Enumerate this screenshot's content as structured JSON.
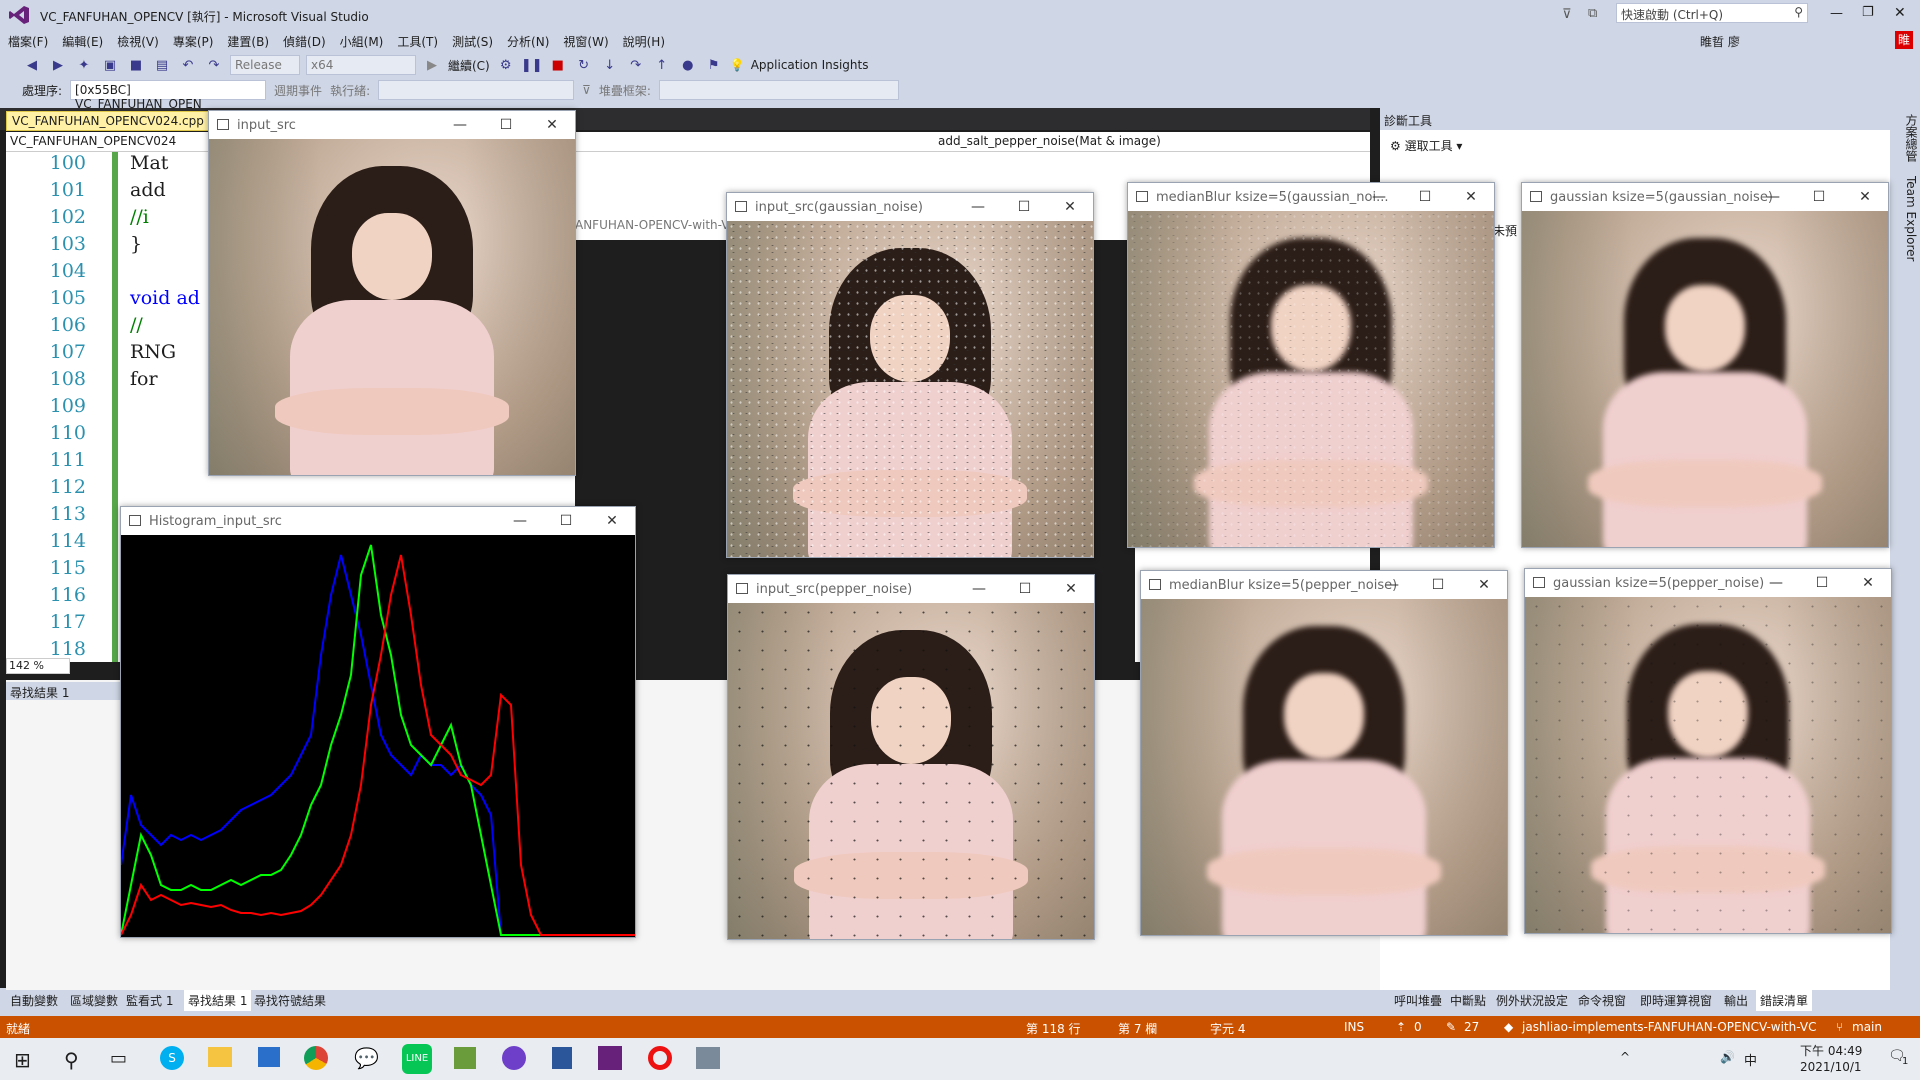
{
  "window": {
    "title": "VC_FANFUHAN_OPENCV [執行] - Microsoft Visual Studio",
    "quick_launch_placeholder": "快速啟動 (Ctrl+Q)",
    "user": "睢晢 廖",
    "user_badge": "睢"
  },
  "menu": [
    "檔案(F)",
    "編輯(E)",
    "檢視(V)",
    "專案(P)",
    "建置(B)",
    "偵錯(D)",
    "小組(M)",
    "工具(T)",
    "測試(S)",
    "分析(N)",
    "視窗(W)",
    "說明(H)"
  ],
  "toolbar": {
    "config": "Release",
    "platform": "x64",
    "continue": "繼續(C)",
    "app_insights": "Application Insights"
  },
  "toolbar2": {
    "process_label": "處理序:",
    "process_value": "[0x55BC] VC_FANFUHAN_OPEN",
    "lifecycle": "週期事件",
    "thread_label": "執行緒:",
    "stack_label": "堆疊框架:"
  },
  "editor": {
    "tab": "VC_FANFUHAN_OPENCV024.cpp",
    "nav_left": "VC_FANFUHAN_OPENCV024",
    "nav_right": "add_salt_pepper_noise(Mat & image)",
    "path_fragment": "ANFUHAN-OPENCV-with-V",
    "zoom": "142 %",
    "lines": [
      {
        "n": "100",
        "t": "Mat"
      },
      {
        "n": "101",
        "t": "add"
      },
      {
        "n": "102",
        "t": "//i"
      },
      {
        "n": "103",
        "t": "}"
      },
      {
        "n": "104",
        "t": ""
      },
      {
        "n": "105",
        "t": "void ad"
      },
      {
        "n": "106",
        "t": "//"
      },
      {
        "n": "107",
        "t": "RNG"
      },
      {
        "n": "108",
        "t": "for"
      },
      {
        "n": "109",
        "t": ""
      },
      {
        "n": "110",
        "t": ""
      },
      {
        "n": "111",
        "t": ""
      },
      {
        "n": "112",
        "t": ""
      },
      {
        "n": "113",
        "t": ""
      },
      {
        "n": "114",
        "t": ""
      },
      {
        "n": "115",
        "t": ""
      },
      {
        "n": "116",
        "t": ""
      },
      {
        "n": "117",
        "t": ""
      },
      {
        "n": "118",
        "t": ""
      }
    ]
  },
  "find_panel": {
    "title": "尋找結果 1"
  },
  "diagnostics": {
    "title": "診斷工具",
    "select_tool": "選取工具",
    "side_text": "未預"
  },
  "side_tabs": [
    "方案總管",
    "Team Explorer"
  ],
  "bottom_tabs_left": [
    "自動變數",
    "區域變數",
    "監看式 1",
    "尋找結果 1",
    "尋找符號結果"
  ],
  "bottom_tabs_right": [
    "呼叫堆疊",
    "中斷點",
    "例外狀況設定",
    "命令視窗",
    "即時運算視窗",
    "輸出",
    "錯誤清單"
  ],
  "status": {
    "ready": "就緒",
    "line": "第 118 行",
    "col": "第 7 欄",
    "char": "字元 4",
    "ins": "INS",
    "up": "0",
    "edits": "27",
    "repo": "jashliao-implements-FANFUHAN-OPENCV-with-VC",
    "branch": "main"
  },
  "taskbar": {
    "time": "下午 04:49",
    "date": "2021/10/1",
    "ime": "中",
    "notif": "1"
  },
  "windows": {
    "input_src": "input_src",
    "histogram": "Histogram_input_src",
    "gaussian_noise": "input_src(gaussian_noise)",
    "pepper_noise": "input_src(pepper_noise)",
    "median_gauss": "medianBlur ksize=5(gaussian_noi...",
    "gauss_gauss": "gaussian ksize=5(gaussian_noise)",
    "median_pepper": "medianBlur ksize=5(pepper_noise)",
    "gauss_pepper": "gaussian ksize=5(pepper_noise)"
  },
  "colors": {
    "status_orange": "#ca5100",
    "accent": "#68217a",
    "hist_blue": "#0000ff",
    "hist_green": "#00ff00",
    "hist_red": "#ff0000"
  }
}
